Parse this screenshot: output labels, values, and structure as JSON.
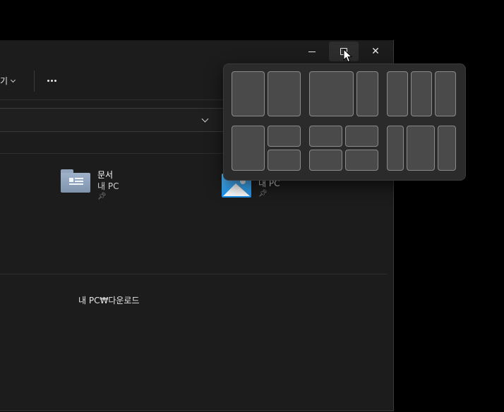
{
  "window": {
    "caption": {
      "minimize_icon": "minimize-icon",
      "maximize_icon": "maximize-icon",
      "close_icon": "close-icon",
      "close_glyph": "✕"
    },
    "toolbar": {
      "view_label": "보기",
      "view_label_visible": "기",
      "more_icon": "more-icon"
    },
    "quick_access": [
      {
        "name": "문서",
        "location": "내 PC",
        "pinned": true,
        "icon": "documents-folder-icon"
      },
      {
        "name": "",
        "location": "내 PC",
        "pinned": true,
        "icon": "pictures-folder-icon"
      }
    ],
    "recent": {
      "path": "내 PC₩다운로드"
    }
  },
  "snap_layouts": {
    "options": [
      "half-half",
      "two-thirds-one-third",
      "three-columns",
      "half-quarters",
      "four-grid",
      "quarter-half-quarter"
    ]
  }
}
